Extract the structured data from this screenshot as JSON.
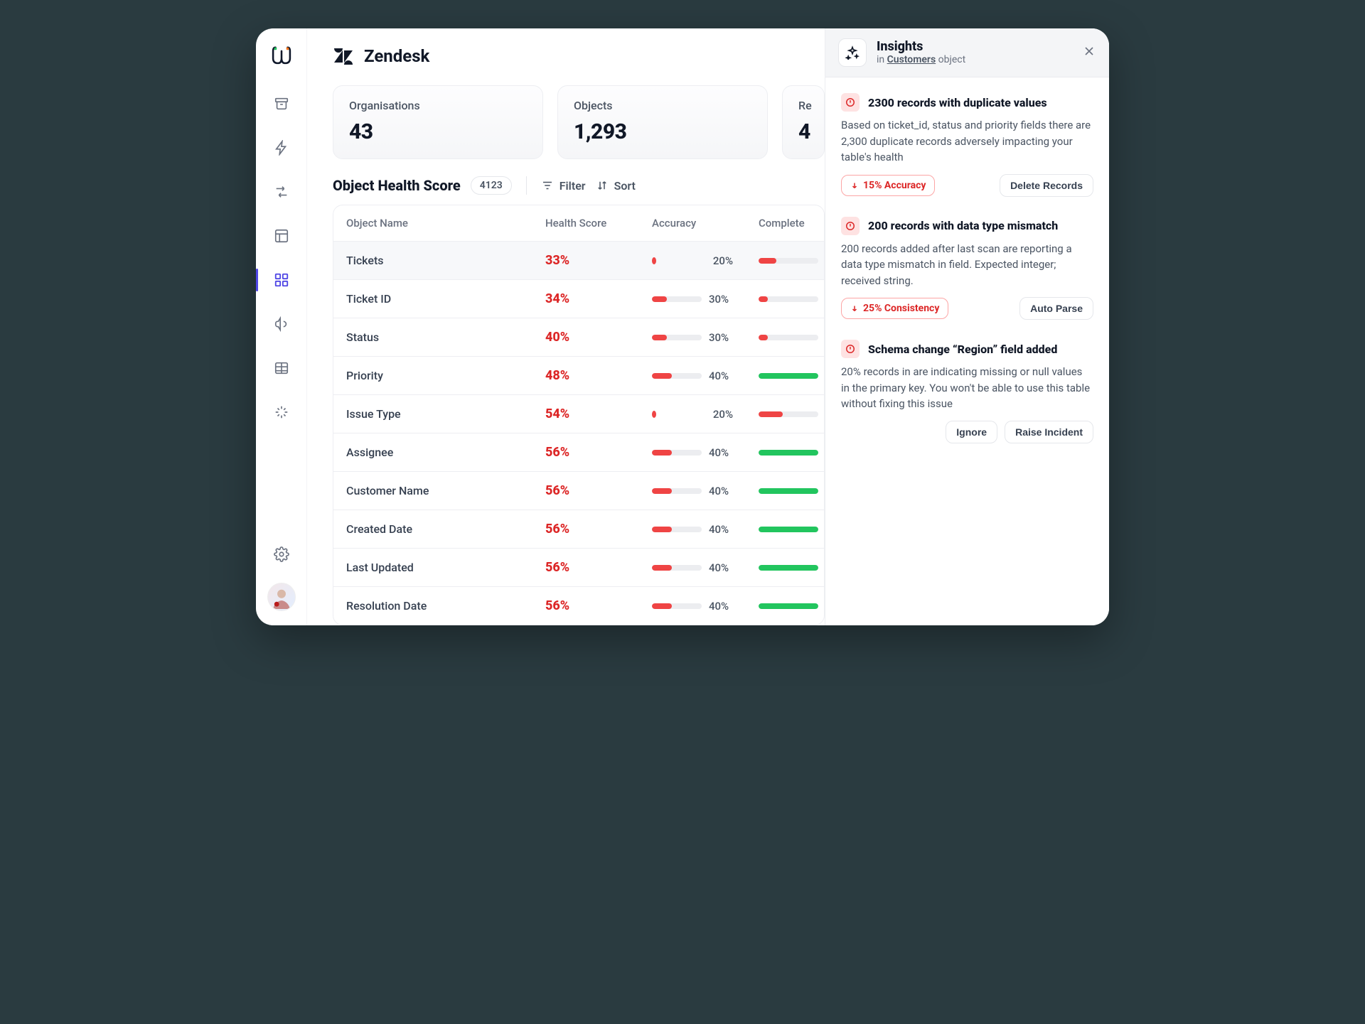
{
  "header": {
    "app_name": "Zendesk"
  },
  "stats": [
    {
      "label": "Organisations",
      "value": "43"
    },
    {
      "label": "Objects",
      "value": "1,293"
    },
    {
      "label": "Re",
      "value": "4"
    }
  ],
  "section": {
    "title": "Object Health Score",
    "count": "4123",
    "filter_label": "Filter",
    "sort_label": "Sort"
  },
  "table": {
    "columns": [
      "Object Name",
      "Health Score",
      "Accuracy",
      "Complete"
    ],
    "rows": [
      {
        "name": "Tickets",
        "score": "33%",
        "accuracy_pct": 20,
        "accuracy_txt": "20%",
        "complete_pct": 30,
        "complete_color": "red",
        "highlight": true,
        "acc_style": "dot"
      },
      {
        "name": "Ticket ID",
        "score": "34%",
        "accuracy_pct": 30,
        "accuracy_txt": "30%",
        "complete_pct": 15,
        "complete_color": "red",
        "highlight": false,
        "acc_style": "bar"
      },
      {
        "name": "Status",
        "score": "40%",
        "accuracy_pct": 30,
        "accuracy_txt": "30%",
        "complete_pct": 15,
        "complete_color": "red",
        "highlight": false,
        "acc_style": "bar"
      },
      {
        "name": "Priority",
        "score": "48%",
        "accuracy_pct": 40,
        "accuracy_txt": "40%",
        "complete_pct": 100,
        "complete_color": "green",
        "highlight": false,
        "acc_style": "bar"
      },
      {
        "name": "Issue Type",
        "score": "54%",
        "accuracy_pct": 20,
        "accuracy_txt": "20%",
        "complete_pct": 40,
        "complete_color": "red",
        "highlight": false,
        "acc_style": "dot"
      },
      {
        "name": "Assignee",
        "score": "56%",
        "accuracy_pct": 40,
        "accuracy_txt": "40%",
        "complete_pct": 100,
        "complete_color": "green",
        "highlight": false,
        "acc_style": "bar"
      },
      {
        "name": "Customer Name",
        "score": "56%",
        "accuracy_pct": 40,
        "accuracy_txt": "40%",
        "complete_pct": 100,
        "complete_color": "green",
        "highlight": false,
        "acc_style": "bar"
      },
      {
        "name": "Created Date",
        "score": "56%",
        "accuracy_pct": 40,
        "accuracy_txt": "40%",
        "complete_pct": 100,
        "complete_color": "green",
        "highlight": false,
        "acc_style": "bar"
      },
      {
        "name": "Last Updated",
        "score": "56%",
        "accuracy_pct": 40,
        "accuracy_txt": "40%",
        "complete_pct": 100,
        "complete_color": "green",
        "highlight": false,
        "acc_style": "bar"
      },
      {
        "name": "Resolution Date",
        "score": "56%",
        "accuracy_pct": 40,
        "accuracy_txt": "40%",
        "complete_pct": 100,
        "complete_color": "green",
        "highlight": false,
        "acc_style": "bar"
      }
    ]
  },
  "panel": {
    "title": "Insights",
    "sub_prefix": "in ",
    "sub_link": "Customers",
    "sub_suffix": " object",
    "insights": [
      {
        "title": "2300 records with duplicate values",
        "desc": "Based on ticket_id, status and priority fields there are 2,300 duplicate records adversely impacting your table's health",
        "metric": "15% Accuracy",
        "action": "Delete Records"
      },
      {
        "title": "200 records with data type mismatch",
        "desc": "200 records added after last scan are reporting a data type mismatch in field. Expected integer; received string.",
        "metric": "25% Consistency",
        "action": "Auto Parse"
      },
      {
        "title": "Schema change “Region” field added",
        "desc": "20% records in are indicating missing or null values in the primary key. You won't be able to use this table without fixing this issue",
        "buttons": [
          "Ignore",
          "Raise Incident"
        ]
      }
    ]
  }
}
